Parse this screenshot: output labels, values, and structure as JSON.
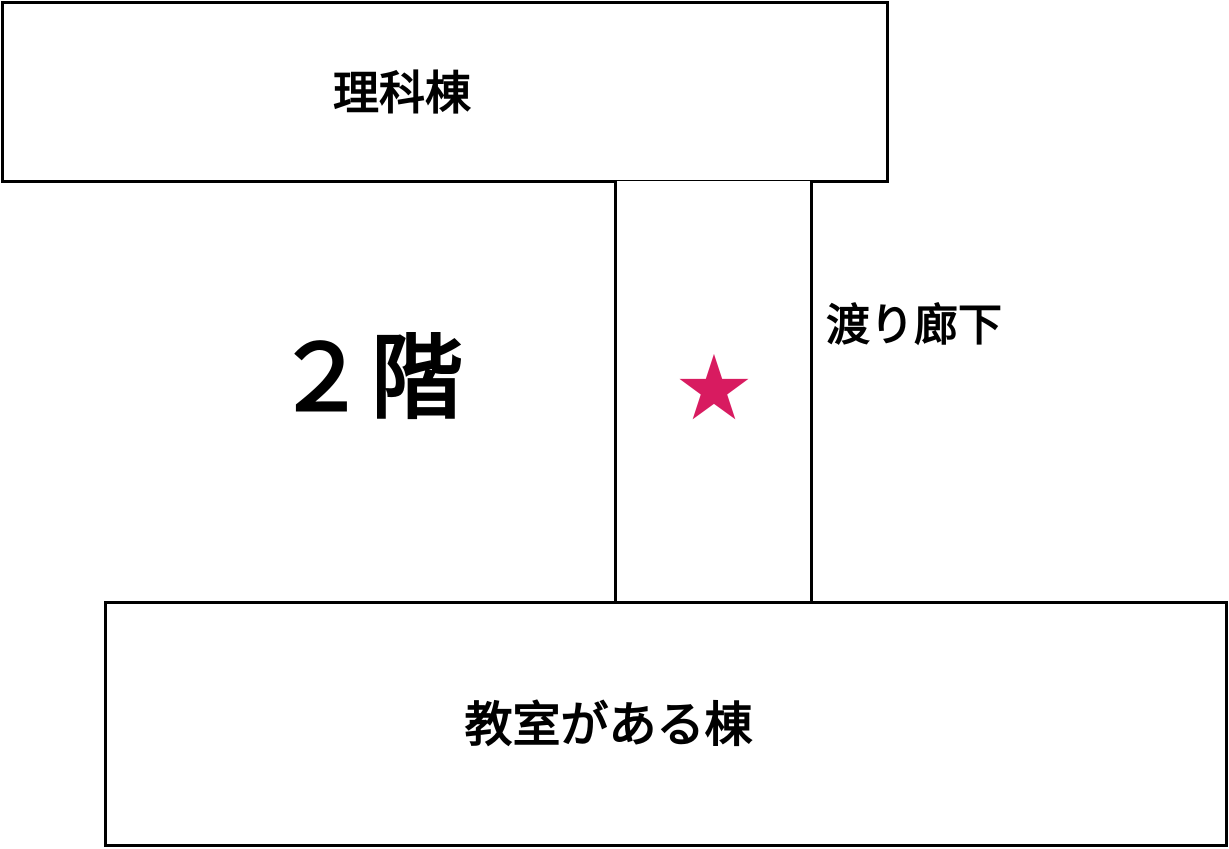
{
  "diagram": {
    "science_building_label": "理科棟",
    "floor_label": "２階",
    "corridor_label": "渡り廊下",
    "classroom_building_label": "教室がある棟",
    "marker": {
      "symbol": "★",
      "color": "#d81b60"
    },
    "colors": {
      "line": "#000000",
      "background": "#ffffff"
    }
  }
}
